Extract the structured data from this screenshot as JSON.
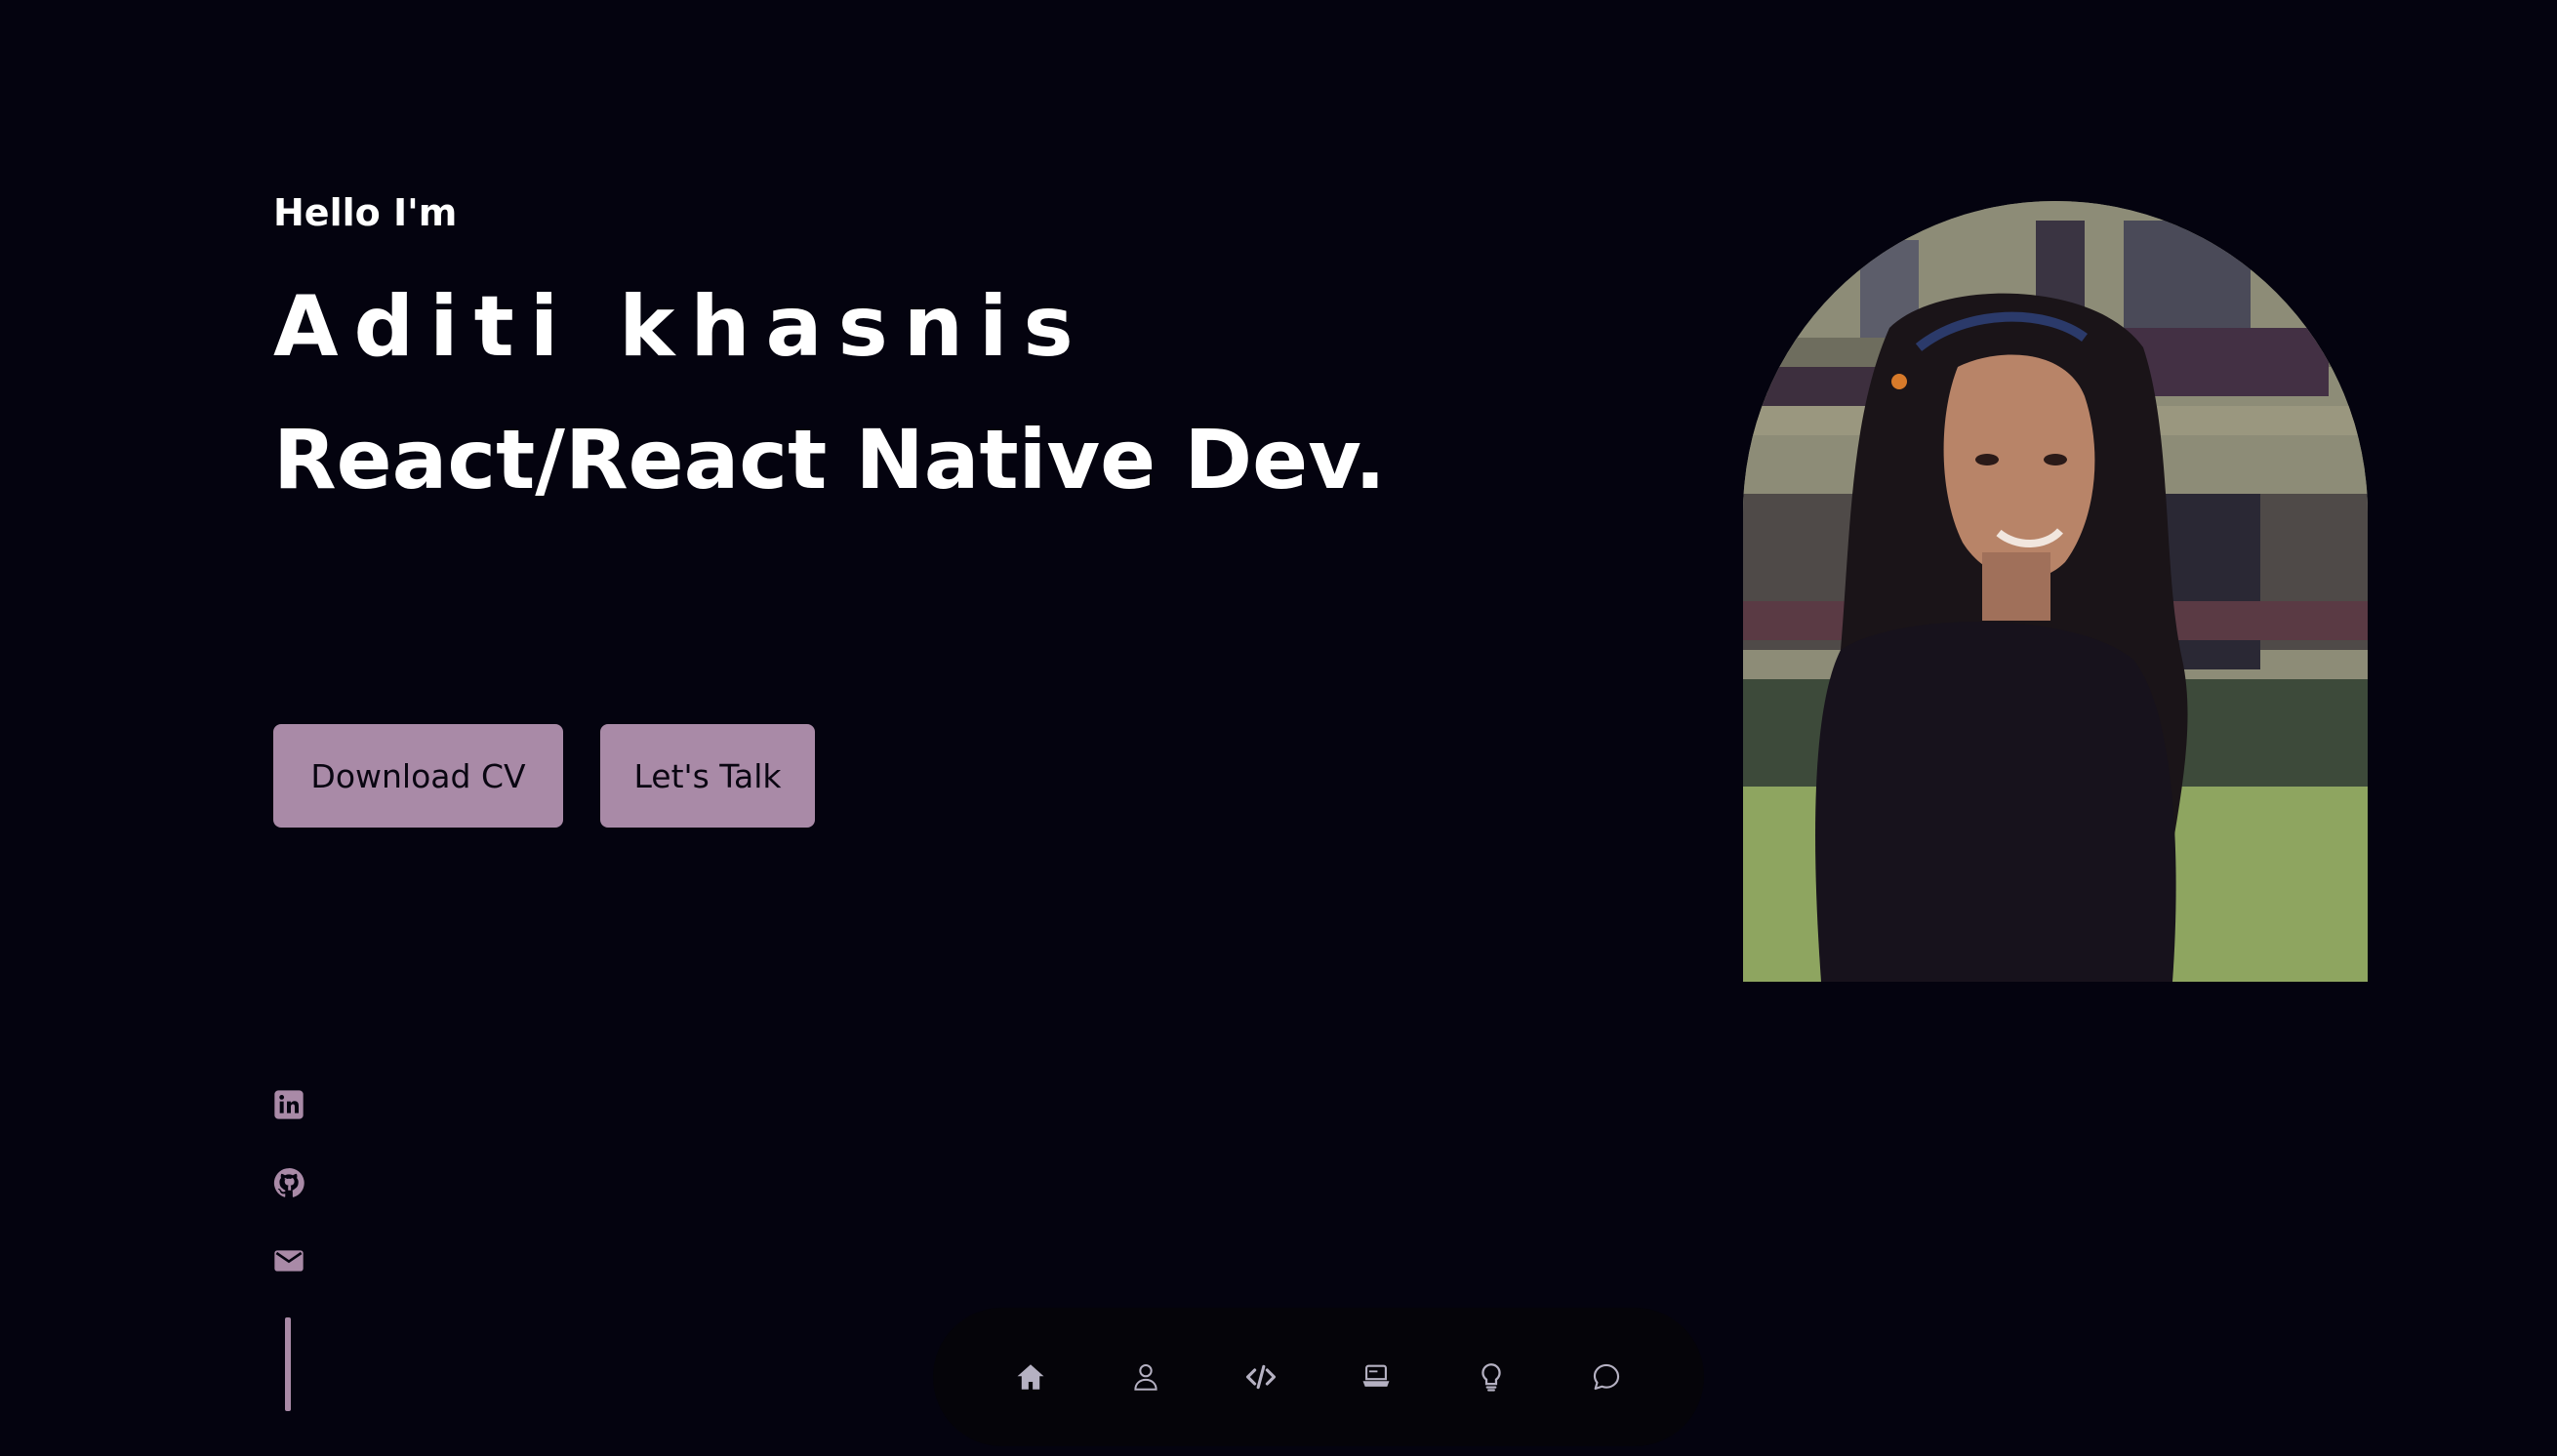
{
  "hero": {
    "greeting": "Hello I'm",
    "name": "Aditi khasnis",
    "role": "React/React Native Dev."
  },
  "actions": {
    "download_cv": "Download CV",
    "lets_talk": "Let's Talk"
  },
  "social": [
    {
      "icon": "linkedin-icon"
    },
    {
      "icon": "github-icon"
    },
    {
      "icon": "mail-icon"
    }
  ],
  "nav": [
    {
      "icon": "home-icon"
    },
    {
      "icon": "user-icon"
    },
    {
      "icon": "code-icon"
    },
    {
      "icon": "laptop-icon"
    },
    {
      "icon": "lightbulb-icon"
    },
    {
      "icon": "chat-icon"
    }
  ],
  "colors": {
    "background": "#04030f",
    "accent": "#a98aa7",
    "text": "#ffffff"
  }
}
